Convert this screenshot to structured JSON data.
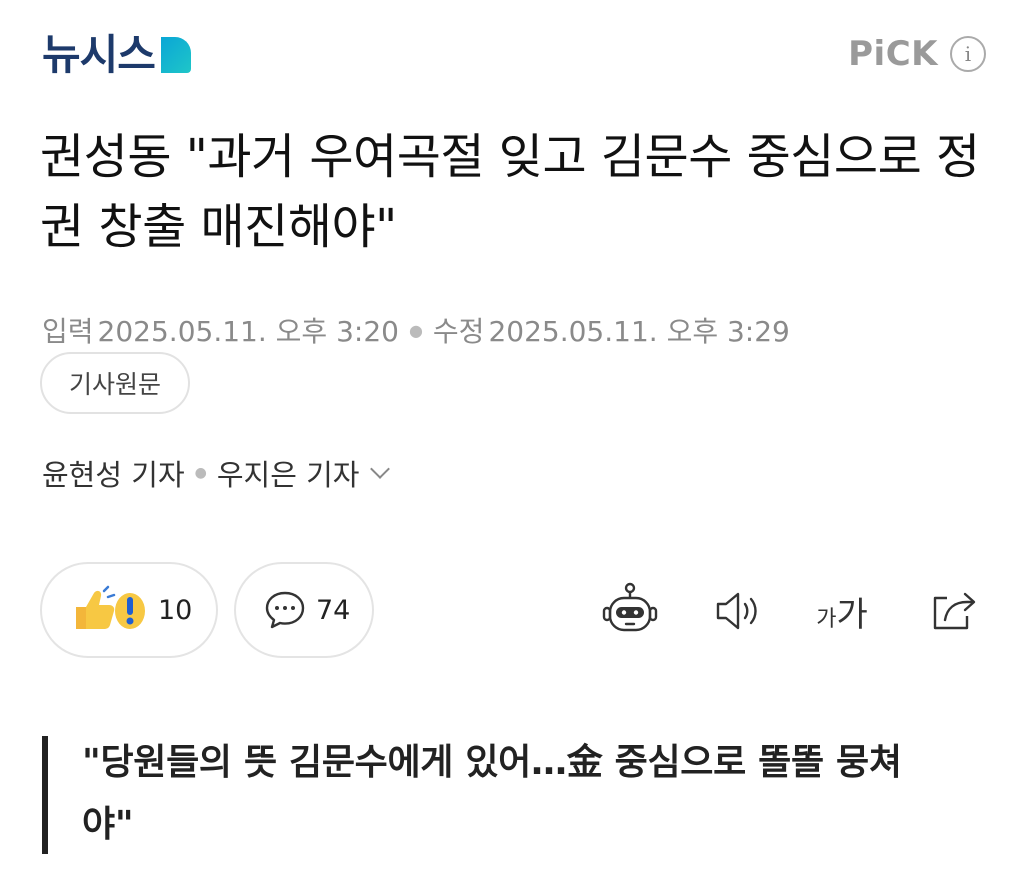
{
  "header": {
    "logo_text": "뉴시스",
    "pick_label": "PiCK",
    "info_icon": "i"
  },
  "article": {
    "title": "권성동 \"과거 우여곡절 잊고 김문수 중심으로 정권 창출 매진해야\"",
    "input_label": "입력",
    "input_time": "2025.05.11. 오후 3:20",
    "edit_label": "수정",
    "edit_time": "2025.05.11. 오후 3:29",
    "origin_button": "기사원문",
    "reporters": [
      "윤현성 기자",
      "우지은 기자"
    ],
    "reaction_count": "10",
    "comment_count": "74",
    "subtitle": "\"당원들의 뜻 김문수에게 있어…金 중심으로 똘똘 뭉쳐야\""
  },
  "toolbar": {
    "fontsize_small": "가",
    "fontsize_large": "가"
  },
  "icons": {
    "brand_accent": "#1d3a6b",
    "logo_mark_color": "#0aa6d6",
    "reaction_icon": "thumbs-up-surprise-icon",
    "comment_icon": "speech-bubble-icon",
    "robot_icon": "robot-summary-icon",
    "speaker_icon": "speaker-icon",
    "fontsize_icon": "font-size-icon",
    "share_icon": "share-icon"
  }
}
